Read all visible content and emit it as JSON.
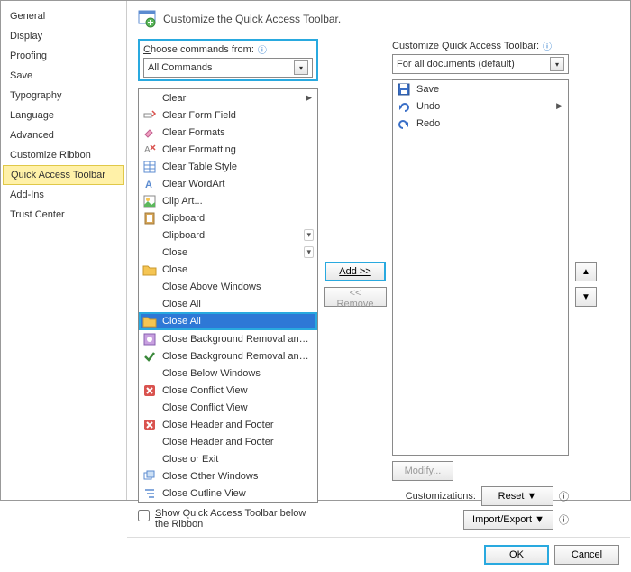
{
  "sidebar": {
    "items": [
      {
        "label": "General"
      },
      {
        "label": "Display"
      },
      {
        "label": "Proofing"
      },
      {
        "label": "Save"
      },
      {
        "label": "Typography"
      },
      {
        "label": "Language"
      },
      {
        "label": "Advanced"
      },
      {
        "label": "Customize Ribbon"
      },
      {
        "label": "Quick Access Toolbar"
      },
      {
        "label": "Add-Ins"
      },
      {
        "label": "Trust Center"
      }
    ],
    "selected_index": 8
  },
  "header": {
    "title": "Customize the Quick Access Toolbar."
  },
  "left": {
    "label": "Choose commands from:",
    "combo_value": "All Commands",
    "items": [
      {
        "icon": "blank",
        "label": "Clear",
        "submenu": true
      },
      {
        "icon": "clear-form",
        "label": "Clear Form Field"
      },
      {
        "icon": "clear-formats",
        "label": "Clear Formats"
      },
      {
        "icon": "clear-formatting",
        "label": "Clear Formatting"
      },
      {
        "icon": "table",
        "label": "Clear Table Style"
      },
      {
        "icon": "wordart",
        "label": "Clear WordArt"
      },
      {
        "icon": "clipart",
        "label": "Clip Art..."
      },
      {
        "icon": "clipboard",
        "label": "Clipboard"
      },
      {
        "icon": "blank",
        "label": "Clipboard",
        "split": true
      },
      {
        "icon": "blank",
        "label": "Close",
        "split": true
      },
      {
        "icon": "folder",
        "label": "Close"
      },
      {
        "icon": "blank",
        "label": "Close Above Windows"
      },
      {
        "icon": "blank",
        "label": "Close All"
      },
      {
        "icon": "folder",
        "label": "Close All"
      },
      {
        "icon": "bg-remove",
        "label": "Close Background Removal and D..."
      },
      {
        "icon": "check",
        "label": "Close Background Removal and K..."
      },
      {
        "icon": "blank",
        "label": "Close Below Windows"
      },
      {
        "icon": "x-red",
        "label": "Close Conflict View"
      },
      {
        "icon": "blank",
        "label": "Close Conflict View"
      },
      {
        "icon": "x-red",
        "label": "Close Header and Footer"
      },
      {
        "icon": "blank",
        "label": "Close Header and Footer"
      },
      {
        "icon": "blank",
        "label": "Close or Exit"
      },
      {
        "icon": "windows",
        "label": "Close Other Windows"
      },
      {
        "icon": "outline",
        "label": "Close Outline View"
      }
    ],
    "selected_index": 13
  },
  "right": {
    "label": "Customize Quick Access Toolbar:",
    "combo_value": "For all documents (default)",
    "items": [
      {
        "icon": "save",
        "label": "Save"
      },
      {
        "icon": "undo",
        "label": "Undo",
        "submenu": true
      },
      {
        "icon": "redo",
        "label": "Redo"
      }
    ]
  },
  "mid": {
    "add": "Add >>",
    "remove": "<< Remove"
  },
  "arrows": {
    "up": "▲",
    "down": "▼"
  },
  "bottom": {
    "checkbox_label": "Show Quick Access Toolbar below the Ribbon",
    "modify": "Modify...",
    "customizations_label": "Customizations:",
    "reset": "Reset ▼",
    "import_export": "Import/Export ▼"
  },
  "footer": {
    "ok": "OK",
    "cancel": "Cancel"
  }
}
